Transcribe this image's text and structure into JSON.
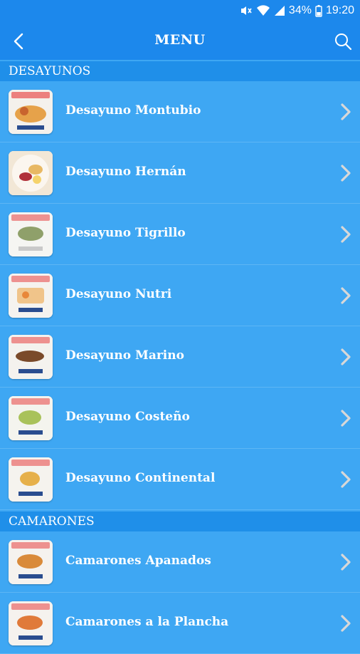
{
  "status_bar": {
    "battery": "34%",
    "time": "19:20",
    "icons": [
      "mute-icon",
      "wifi-icon",
      "signal-icon",
      "battery-icon"
    ]
  },
  "app_bar": {
    "title": "MENU",
    "back_icon": "back-arrow-icon",
    "search_icon": "search-icon"
  },
  "sections": [
    {
      "title": "DESAYUNOS",
      "items": [
        {
          "label": "Desayuno Montubio"
        },
        {
          "label": "Desayuno Hernán"
        },
        {
          "label": "Desayuno Tigrillo"
        },
        {
          "label": "Desayuno Nutri"
        },
        {
          "label": "Desayuno Marino"
        },
        {
          "label": "Desayuno Costeño"
        },
        {
          "label": "Desayuno Continental"
        }
      ]
    },
    {
      "title": "CAMARONES",
      "items": [
        {
          "label": "Camarones Apanados"
        },
        {
          "label": "Camarones a la Plancha"
        }
      ]
    }
  ],
  "colors": {
    "primary": "#1c88ec",
    "list_background": "#3ea7f3",
    "section_header": "#1f8fe9",
    "chevron": "#d8d8d8"
  }
}
